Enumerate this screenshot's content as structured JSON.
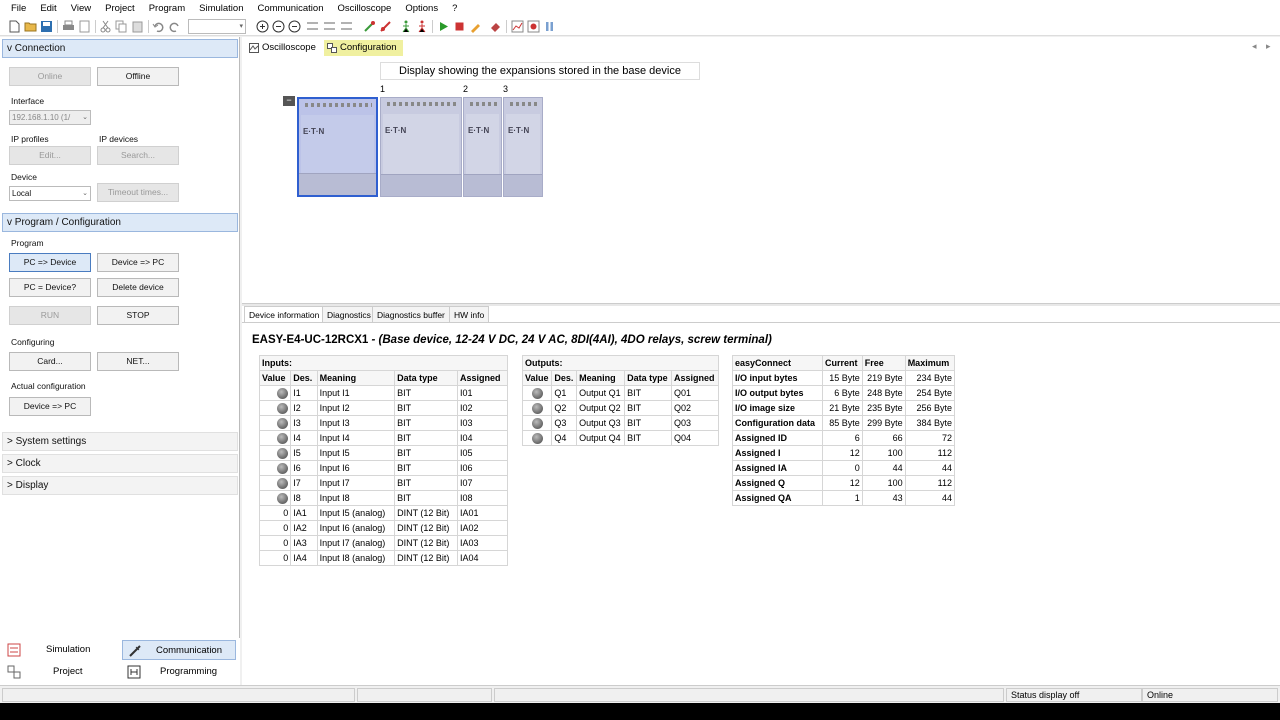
{
  "menu": [
    "File",
    "Edit",
    "View",
    "Project",
    "Program",
    "Simulation",
    "Communication",
    "Oscilloscope",
    "Options",
    "?"
  ],
  "left": {
    "connection": {
      "header": "Connection",
      "online": "Online",
      "offline": "Offline",
      "interface_label": "Interface",
      "interface_value": "192.168.1.10 (1/",
      "ip_profiles_label": "IP profiles",
      "ip_devices_label": "IP devices",
      "edit": "Edit...",
      "search": "Search...",
      "device_label": "Device",
      "device_value": "Local",
      "timeout": "Timeout times..."
    },
    "program": {
      "header": "Program / Configuration",
      "program_label": "Program",
      "pc_to_device": "PC => Device",
      "device_to_pc": "Device => PC",
      "pc_eq_device": "PC = Device?",
      "delete_device": "Delete device",
      "run": "RUN",
      "stop": "STOP",
      "configuring_label": "Configuring",
      "card": "Card...",
      "net": "NET...",
      "actual_label": "Actual configuration",
      "actual_device_to_pc": "Device => PC"
    },
    "collapsed": [
      "System settings",
      "Clock",
      "Display"
    ],
    "nav": {
      "simulation": "Simulation",
      "communication": "Communication",
      "project": "Project",
      "programming": "Programming"
    }
  },
  "right": {
    "tabs": [
      "Oscilloscope",
      "Configuration"
    ],
    "display_caption": "Display showing the expansions stored in the base device",
    "module_numbers": [
      "1",
      "2",
      "3"
    ],
    "brand": "E·T·N",
    "bottom_tabs": [
      "Device information",
      "Diagnostics",
      "Diagnostics buffer",
      "HW info"
    ],
    "device_title": "EASY-E4-UC-12RCX1",
    "device_desc": " - (Base device, 12-24 V DC, 24 V AC, 8DI(4AI), 4DO relays, screw terminal)",
    "inputs": {
      "title": "Inputs:",
      "headers": [
        "Value",
        "Des.",
        "Meaning",
        "Data type",
        "Assigned"
      ],
      "rows": [
        {
          "value": "",
          "des": "I1",
          "meaning": "Input I1",
          "type": "BIT",
          "assigned": "I01",
          "led": true
        },
        {
          "value": "",
          "des": "I2",
          "meaning": "Input I2",
          "type": "BIT",
          "assigned": "I02",
          "led": true
        },
        {
          "value": "",
          "des": "I3",
          "meaning": "Input I3",
          "type": "BIT",
          "assigned": "I03",
          "led": true
        },
        {
          "value": "",
          "des": "I4",
          "meaning": "Input I4",
          "type": "BIT",
          "assigned": "I04",
          "led": true
        },
        {
          "value": "",
          "des": "I5",
          "meaning": "Input I5",
          "type": "BIT",
          "assigned": "I05",
          "led": true
        },
        {
          "value": "",
          "des": "I6",
          "meaning": "Input I6",
          "type": "BIT",
          "assigned": "I06",
          "led": true
        },
        {
          "value": "",
          "des": "I7",
          "meaning": "Input I7",
          "type": "BIT",
          "assigned": "I07",
          "led": true
        },
        {
          "value": "",
          "des": "I8",
          "meaning": "Input I8",
          "type": "BIT",
          "assigned": "I08",
          "led": true
        },
        {
          "value": "0",
          "des": "IA1",
          "meaning": "Input I5 (analog)",
          "type": "DINT (12 Bit)",
          "assigned": "IA01",
          "led": false
        },
        {
          "value": "0",
          "des": "IA2",
          "meaning": "Input I6 (analog)",
          "type": "DINT (12 Bit)",
          "assigned": "IA02",
          "led": false
        },
        {
          "value": "0",
          "des": "IA3",
          "meaning": "Input I7 (analog)",
          "type": "DINT (12 Bit)",
          "assigned": "IA03",
          "led": false
        },
        {
          "value": "0",
          "des": "IA4",
          "meaning": "Input I8 (analog)",
          "type": "DINT (12 Bit)",
          "assigned": "IA04",
          "led": false
        }
      ]
    },
    "outputs": {
      "title": "Outputs:",
      "headers": [
        "Value",
        "Des.",
        "Meaning",
        "Data type",
        "Assigned"
      ],
      "rows": [
        {
          "des": "Q1",
          "meaning": "Output Q1",
          "type": "BIT",
          "assigned": "Q01"
        },
        {
          "des": "Q2",
          "meaning": "Output Q2",
          "type": "BIT",
          "assigned": "Q02"
        },
        {
          "des": "Q3",
          "meaning": "Output Q3",
          "type": "BIT",
          "assigned": "Q03"
        },
        {
          "des": "Q4",
          "meaning": "Output Q4",
          "type": "BIT",
          "assigned": "Q04"
        }
      ]
    },
    "easyconnect": {
      "headers": [
        "easyConnect",
        "Current",
        "Free",
        "Maximum"
      ],
      "rows": [
        [
          "I/O input bytes",
          "15 Byte",
          "219 Byte",
          "234 Byte"
        ],
        [
          "I/O output bytes",
          "6 Byte",
          "248 Byte",
          "254 Byte"
        ],
        [
          "I/O image size",
          "21 Byte",
          "235 Byte",
          "256 Byte"
        ],
        [
          "Configuration data",
          "85 Byte",
          "299 Byte",
          "384 Byte"
        ],
        [
          "Assigned ID",
          "6",
          "66",
          "72"
        ],
        [
          "Assigned I",
          "12",
          "100",
          "112"
        ],
        [
          "Assigned IA",
          "0",
          "44",
          "44"
        ],
        [
          "Assigned Q",
          "12",
          "100",
          "112"
        ],
        [
          "Assigned QA",
          "1",
          "43",
          "44"
        ]
      ]
    }
  },
  "status": {
    "display": "Status display off",
    "state": "Online"
  }
}
